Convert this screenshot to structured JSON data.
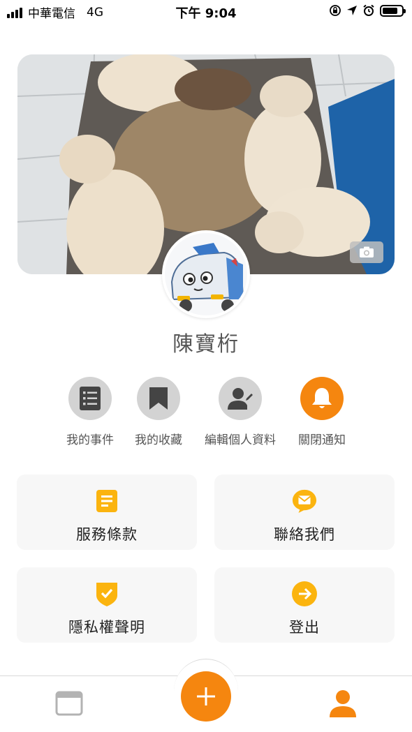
{
  "status_bar": {
    "carrier": "中華電信",
    "network": "4G",
    "time": "下午 9:04",
    "battery_level": 0.8
  },
  "profile": {
    "name": "陳寶桁",
    "cover_photo": "french-bulldogs-sleeping-photo",
    "avatar": "cartoon-car-avatar"
  },
  "quick_actions": [
    {
      "label": "我的事件",
      "icon": "list-icon"
    },
    {
      "label": "我的收藏",
      "icon": "bookmark-icon"
    },
    {
      "label": "編輯個人資料",
      "icon": "edit-user-icon"
    },
    {
      "label": "關閉通知",
      "icon": "bell-icon"
    }
  ],
  "menu_cards": [
    {
      "label": "服務條款",
      "icon": "document-icon"
    },
    {
      "label": "聯絡我們",
      "icon": "mail-icon"
    },
    {
      "label": "隱私權聲明",
      "icon": "shield-check-icon"
    },
    {
      "label": "登出",
      "icon": "arrow-right-icon"
    }
  ],
  "tab_bar": {
    "items": [
      "browser-icon",
      "add-icon",
      "user-icon"
    ]
  },
  "colors": {
    "accent": "#f5860f",
    "icon_yellow": "#fbb40f",
    "inactive_circle": "#d3d3d3",
    "card_bg": "#f7f7f7"
  }
}
